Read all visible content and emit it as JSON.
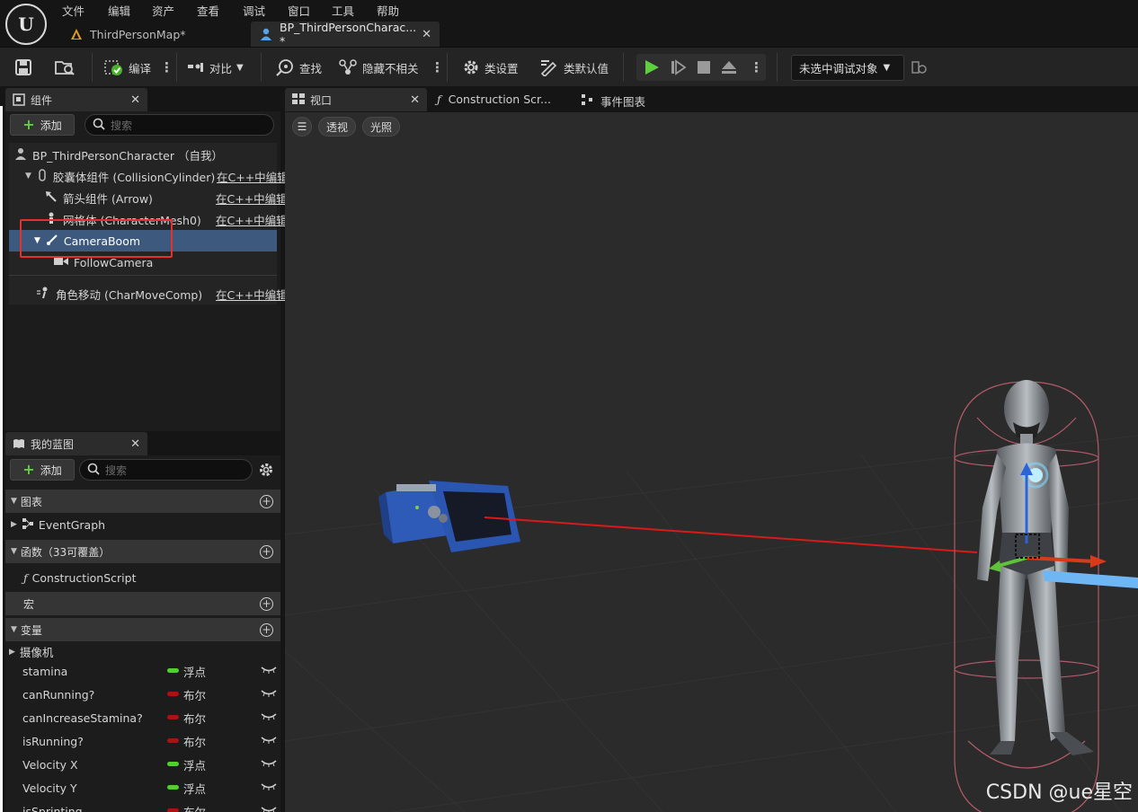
{
  "menu": [
    "文件",
    "编辑",
    "资产",
    "查看",
    "调试",
    "窗口",
    "工具",
    "帮助"
  ],
  "doc_tabs": [
    {
      "label": "ThirdPersonMap*"
    },
    {
      "label": "BP_ThirdPersonCharac... *"
    }
  ],
  "toolbar": {
    "compile": "编译",
    "diff": "对比",
    "find": "查找",
    "hide_unrelated": "隐藏不相关",
    "class_settings": "类设置",
    "class_defaults": "类默认值",
    "debug_target": "未选中调试对象"
  },
  "components_panel": {
    "title": "组件",
    "add": "添加",
    "search_placeholder": "搜索",
    "items": [
      {
        "label": "BP_ThirdPersonCharacter （自我）",
        "edit": ""
      },
      {
        "label": "胶囊体组件 (CollisionCylinder)",
        "edit": "在C++中编辑"
      },
      {
        "label": "箭头组件 (Arrow)",
        "edit": "在C++中编辑"
      },
      {
        "label": "网格体 (CharacterMesh0)",
        "edit": "在C++中编辑"
      },
      {
        "label": "CameraBoom",
        "edit": ""
      },
      {
        "label": "FollowCamera",
        "edit": ""
      },
      {
        "label": "角色移动 (CharMoveComp)",
        "edit": "在C++中编辑"
      }
    ]
  },
  "viewport_tabs": [
    "视口",
    "Construction Scr...",
    "事件图表"
  ],
  "viewport": {
    "perspective": "透视",
    "lit": "光照",
    "watermark": "CSDN @ue星空"
  },
  "my_blueprint": {
    "title": "我的蓝图",
    "add": "添加",
    "search_placeholder": "搜索",
    "sections": {
      "graphs": "图表",
      "event_graph": "EventGraph",
      "functions": "函数（33可覆盖）",
      "construction_script": "ConstructionScript",
      "macros": "宏",
      "variables": "变量",
      "camera_category": "摄像机"
    },
    "variables": [
      {
        "name": "stamina",
        "type": "浮点",
        "color": "#4fd02a"
      },
      {
        "name": "canRunning?",
        "type": "布尔",
        "color": "#a81313"
      },
      {
        "name": "canIncreaseStamina?",
        "type": "布尔",
        "color": "#a81313"
      },
      {
        "name": "isRunning?",
        "type": "布尔",
        "color": "#a81313"
      },
      {
        "name": "Velocity X",
        "type": "浮点",
        "color": "#4fd02a"
      },
      {
        "name": "Velocity Y",
        "type": "浮点",
        "color": "#4fd02a"
      },
      {
        "name": "isSprinting",
        "type": "布尔",
        "color": "#a81313"
      }
    ]
  },
  "colors": {
    "accent_selection": "#3d5a7e",
    "highlight_box": "#e53030",
    "play_green": "#5fcf42"
  }
}
